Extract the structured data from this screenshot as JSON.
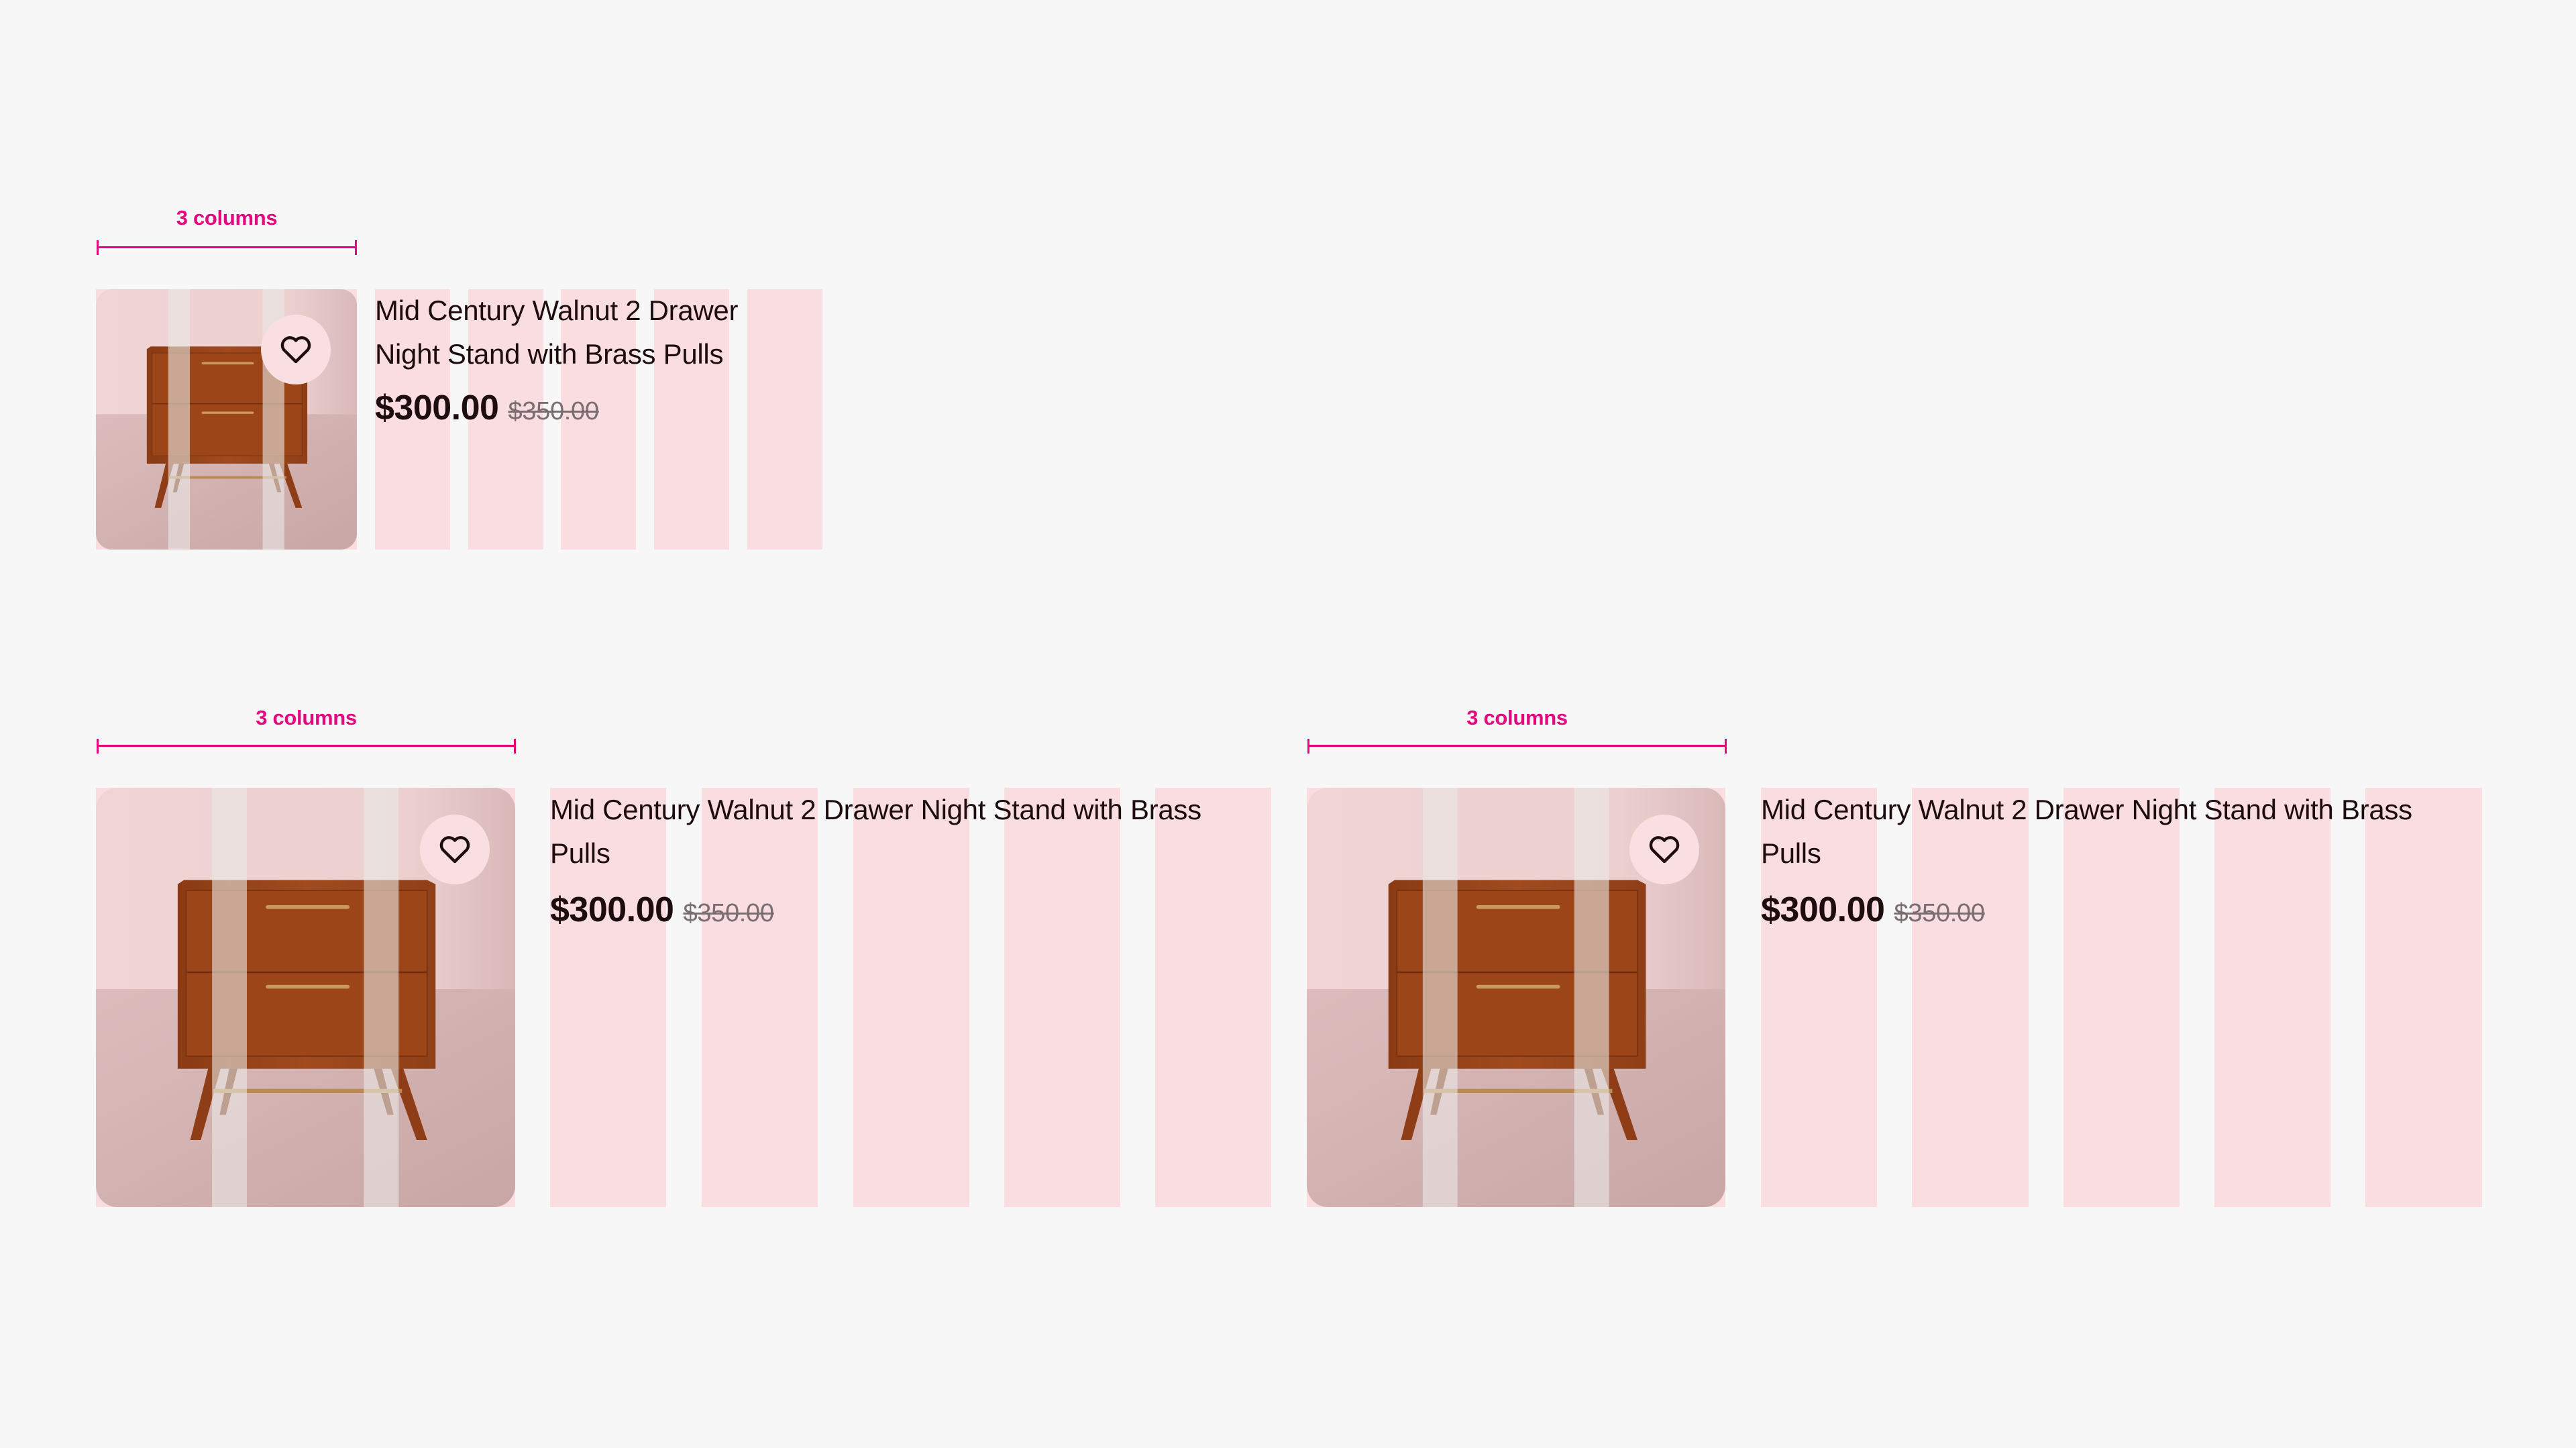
{
  "colors": {
    "background": "#f7f7f7",
    "grid_column": "#f9dde0",
    "annotation": "#e3067f",
    "text": "#1d0d0f",
    "old_price": "#7a6e70"
  },
  "layouts": [
    {
      "id": "small",
      "annotation_label": "3 columns",
      "image_span_columns": 3,
      "text_columns": 5,
      "product": {
        "title": "Mid Century Walnut 2 Drawer Night Stand with Brass Pulls",
        "price": "$300.00",
        "original_price": "$350.00",
        "favorite_icon": "heart-outline-icon"
      }
    },
    {
      "id": "large-left",
      "annotation_label": "3 columns",
      "image_span_columns": 3,
      "text_columns": 5,
      "product": {
        "title": "Mid Century Walnut 2 Drawer Night Stand with Brass Pulls",
        "price": "$300.00",
        "original_price": "$350.00",
        "favorite_icon": "heart-outline-icon"
      }
    },
    {
      "id": "large-right",
      "annotation_label": "3 columns",
      "image_span_columns": 3,
      "text_columns": 5,
      "product": {
        "title": "Mid Century Walnut 2 Drawer Night Stand with Brass Pulls",
        "price": "$300.00",
        "original_price": "$350.00",
        "favorite_icon": "heart-outline-icon"
      }
    }
  ]
}
